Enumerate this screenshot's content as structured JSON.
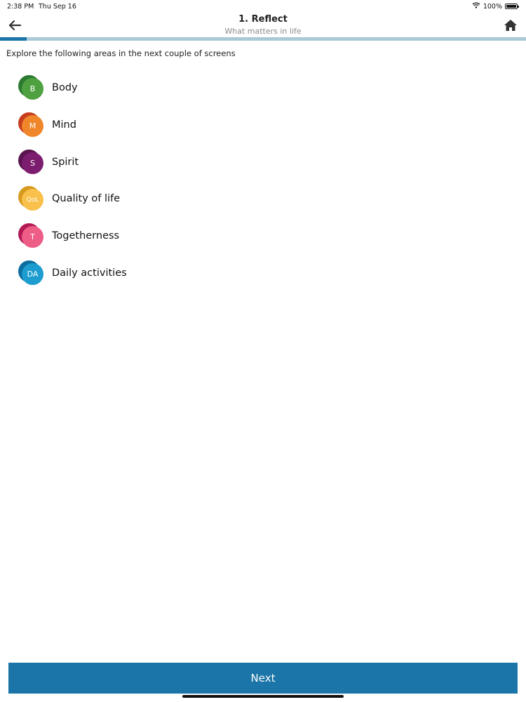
{
  "status": {
    "time": "2:38 PM",
    "date": "Thu Sep 16",
    "battery": "100%"
  },
  "header": {
    "title": "1. Reflect",
    "subtitle": "What matters in life"
  },
  "progress": {
    "fraction": 0.05
  },
  "intro": "Explore the following areas in the next couple of screens",
  "areas": [
    {
      "abbr": "B",
      "label": "Body",
      "front": "#4ea040",
      "back": "#2c7a32"
    },
    {
      "abbr": "M",
      "label": "Mind",
      "front": "#f0862a",
      "back": "#c53d1d"
    },
    {
      "abbr": "S",
      "label": "Spirit",
      "front": "#7d1d6f",
      "back": "#5a1450"
    },
    {
      "abbr": "QoL",
      "label": "Quality of life",
      "front": "#f9c04b",
      "back": "#d79a1e"
    },
    {
      "abbr": "T",
      "label": "Togetherness",
      "front": "#ee5d86",
      "back": "#b31a55"
    },
    {
      "abbr": "DA",
      "label": "Daily activities",
      "front": "#1c9ccf",
      "back": "#0e6e9f"
    }
  ],
  "next_label": "Next",
  "colors": {
    "accent": "#1b75a8",
    "progress_track": "#a9c9d6"
  }
}
